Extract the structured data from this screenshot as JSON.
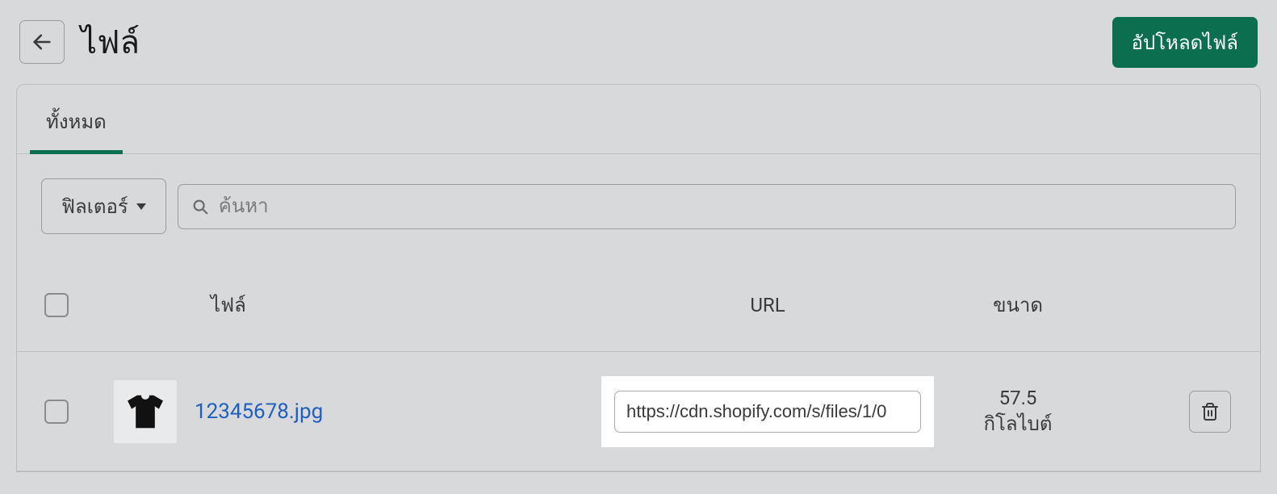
{
  "header": {
    "title": "ไฟล์",
    "upload_label": "อัปโหลดไฟล์"
  },
  "tabs": {
    "all_label": "ทั้งหมด"
  },
  "toolbar": {
    "filter_label": "ฟิลเตอร์",
    "search_placeholder": "ค้นหา"
  },
  "table": {
    "columns": {
      "file": "ไฟล์",
      "url": "URL",
      "size": "ขนาด"
    },
    "rows": [
      {
        "filename": "12345678.jpg",
        "url": "https://cdn.shopify.com/s/files/1/0",
        "size": "57.5\nกิโลไบต์"
      }
    ]
  }
}
